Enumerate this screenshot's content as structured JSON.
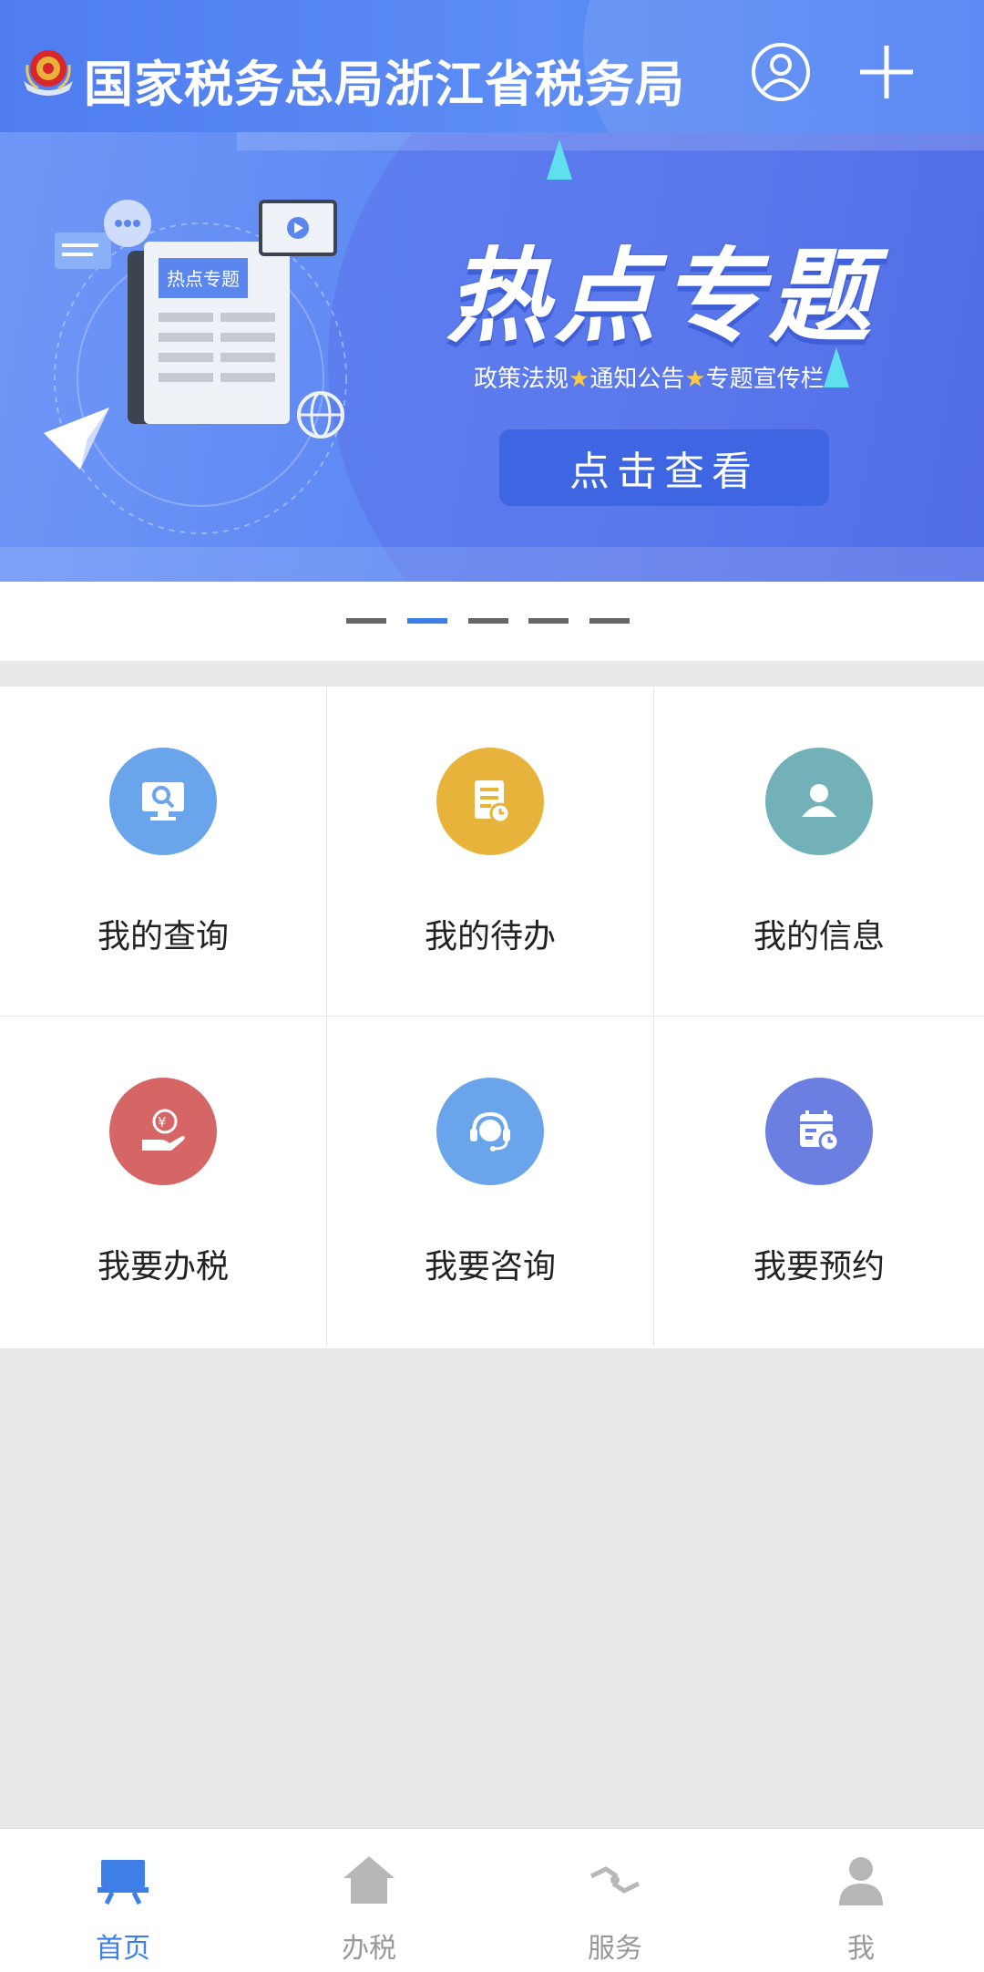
{
  "header": {
    "title": "国家税务总局浙江省税务局",
    "user_icon": "user-circle-icon",
    "add_icon": "plus-icon"
  },
  "banner": {
    "art_label": "热点专题",
    "title": "热点专题",
    "subtitle_parts": [
      "政策法规",
      "通知公告",
      "专题宣传栏"
    ],
    "button_label": "点击查看",
    "page_count": 5,
    "active_page": 2
  },
  "grid": {
    "items": [
      {
        "label": "我的查询",
        "icon": "monitor-search-icon",
        "color": "#6aa5ec"
      },
      {
        "label": "我的待办",
        "icon": "document-clock-icon",
        "color": "#e8b33a"
      },
      {
        "label": "我的信息",
        "icon": "person-icon",
        "color": "#73b1b9"
      },
      {
        "label": "我要办税",
        "icon": "hand-tax-icon",
        "color": "#d66565"
      },
      {
        "label": "我要咨询",
        "icon": "headset-icon",
        "color": "#6aa5ec"
      },
      {
        "label": "我要预约",
        "icon": "calendar-clock-icon",
        "color": "#6b7fe0"
      }
    ]
  },
  "tabbar": {
    "items": [
      {
        "label": "首页",
        "icon": "home-board-icon",
        "active": true
      },
      {
        "label": "办税",
        "icon": "house-icon",
        "active": false
      },
      {
        "label": "服务",
        "icon": "handshake-icon",
        "active": false
      },
      {
        "label": "我",
        "icon": "person-icon",
        "active": false
      }
    ]
  },
  "colors": {
    "accent": "#3d7fe6",
    "header": "#5585f2",
    "inactive": "#999999"
  }
}
